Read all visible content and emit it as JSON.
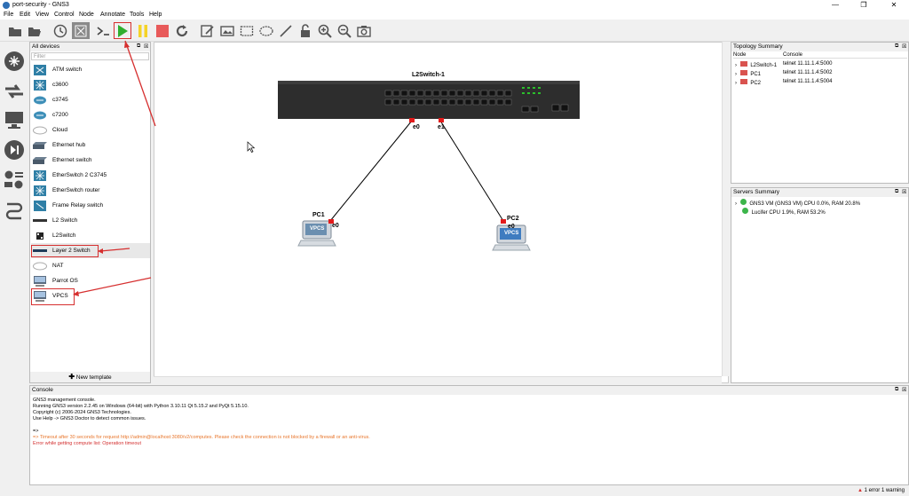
{
  "window": {
    "title": "port-security - GNS3",
    "minimize": "—",
    "maximize": "❐",
    "close": "✕"
  },
  "menu": [
    "File",
    "Edit",
    "View",
    "Control",
    "Node",
    "Annotate",
    "Tools",
    "Help"
  ],
  "devices_panel": {
    "title": "All devices",
    "filter_placeholder": "Filter",
    "items": [
      "ATM switch",
      "c3600",
      "c3745",
      "c7200",
      "Cloud",
      "Ethernet hub",
      "Ethernet switch",
      "EtherSwitch 2 C3745",
      "EtherSwitch router",
      "Frame Relay switch",
      "L2 Switch",
      "L2Switch",
      "Layer 2 Switch",
      "NAT",
      "Parrot OS",
      "VPCS"
    ],
    "new_template": "New template"
  },
  "topology": {
    "switch_label": "L2Switch-1",
    "switch_port_left": "e0",
    "switch_port_right": "e1",
    "pc1_label": "PC1",
    "pc1_port": "e0",
    "pc1_screen": "VPCS",
    "pc2_label": "PC2",
    "pc2_port": "e0",
    "pc2_screen": "VPCS"
  },
  "topology_summary": {
    "title": "Topology Summary",
    "col_node": "Node",
    "col_console": "Console",
    "rows": [
      {
        "node": "L2Switch-1",
        "console": "telnet 11.11.1.4:5000"
      },
      {
        "node": "PC1",
        "console": "telnet 11.11.1.4:5002"
      },
      {
        "node": "PC2",
        "console": "telnet 11.11.1.4:5004"
      }
    ]
  },
  "servers_summary": {
    "title": "Servers Summary",
    "rows": [
      "GNS3 VM (GNS3 VM) CPU 0.0%, RAM 20.8%",
      "Lucifer CPU 1.9%, RAM 53.2%"
    ]
  },
  "console": {
    "title": "Console",
    "lines": [
      "GNS3 management console.",
      "Running GNS3 version 2.2.45 on Windows (64-bit) with Python 3.10.11 Qt 5.15.2 and PyQt 5.15.10.",
      "Copyright (c) 2006-2024 GNS3 Technologies.",
      "Use Help -> GNS3 Doctor to detect common issues.",
      "",
      "=>"
    ],
    "warning_line": "=> Timeout after 30 seconds for request http://admin@localhost:3080/v2/computes. Please check the connection is not blocked by a firewall or an anti-virus.",
    "error_line": "Error while getting compute list: Operation timeout"
  },
  "status": {
    "text": "1 error 1 warning"
  },
  "colors": {
    "accent_red": "#d62f2f",
    "play_green": "#2fae2f",
    "pause_yellow": "#f5d327",
    "stop_red": "#e85a5a"
  }
}
